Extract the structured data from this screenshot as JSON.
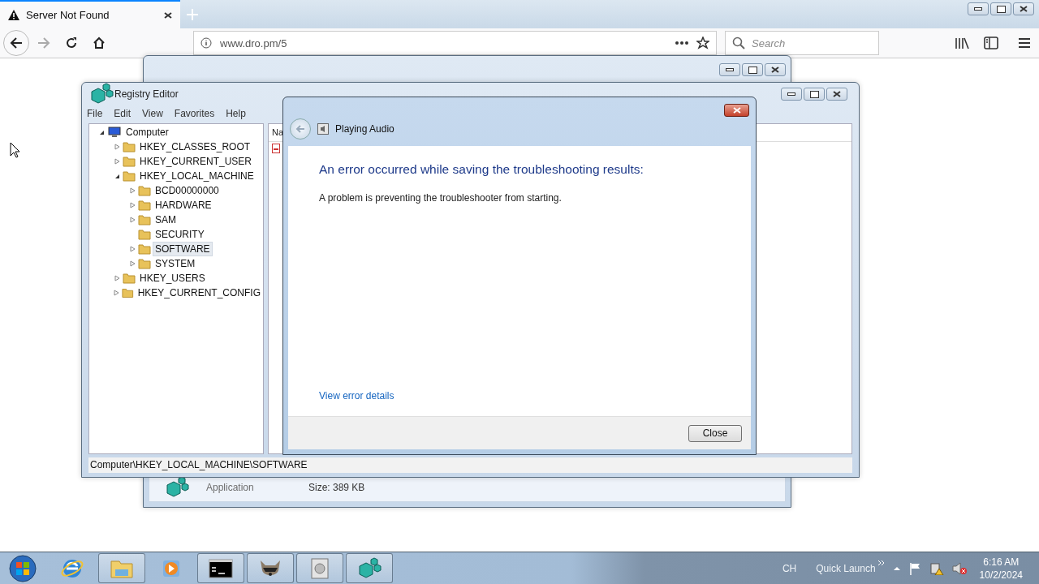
{
  "browser": {
    "tab": {
      "title": "Server Not Found"
    },
    "address": "www.dro.pm/5",
    "search": {
      "placeholder": "Search"
    }
  },
  "back_window": {
    "type_label": "Application",
    "size": "Size: 389 KB"
  },
  "registry_editor": {
    "title": "Registry Editor",
    "menu": [
      "File",
      "Edit",
      "View",
      "Favorites",
      "Help"
    ],
    "tree": [
      {
        "label": "Computer",
        "expanded": true,
        "selected": false,
        "children": [
          {
            "label": "HKEY_CLASSES_ROOT",
            "expanded": false,
            "selected": false
          },
          {
            "label": "HKEY_CURRENT_USER",
            "expanded": false,
            "selected": false
          },
          {
            "label": "HKEY_LOCAL_MACHINE",
            "expanded": true,
            "selected": false,
            "children": [
              {
                "label": "BCD00000000",
                "expanded": false,
                "selected": false
              },
              {
                "label": "HARDWARE",
                "expanded": false,
                "selected": false
              },
              {
                "label": "SAM",
                "expanded": false,
                "selected": false
              },
              {
                "label": "SECURITY",
                "selected": false
              },
              {
                "label": "SOFTWARE",
                "expanded": false,
                "selected": true
              },
              {
                "label": "SYSTEM",
                "expanded": false,
                "selected": false
              }
            ]
          },
          {
            "label": "HKEY_USERS",
            "expanded": false,
            "selected": false
          },
          {
            "label": "HKEY_CURRENT_CONFIG",
            "expanded": false,
            "selected": false
          }
        ]
      }
    ],
    "list_header": "Na",
    "status_bar": "Computer\\HKEY_LOCAL_MACHINE\\SOFTWARE"
  },
  "dialog": {
    "title": "Playing Audio",
    "heading": "An error occurred while saving the troubleshooting results:",
    "message": "A problem is preventing the troubleshooter from starting.",
    "link": "View error details",
    "button": "Close"
  },
  "taskbar": {
    "apps": [
      {
        "kind": "ie",
        "open": false
      },
      {
        "kind": "explorer",
        "open": true
      },
      {
        "kind": "media",
        "open": false
      },
      {
        "kind": "cmd",
        "open": true
      },
      {
        "kind": "raccoon",
        "open": true
      },
      {
        "kind": "disk",
        "open": true
      },
      {
        "kind": "regedit",
        "open": true
      }
    ],
    "language": "CH",
    "quick_launch": "Quick Launch",
    "time": "6:16 AM",
    "date": "10/2/2024"
  }
}
